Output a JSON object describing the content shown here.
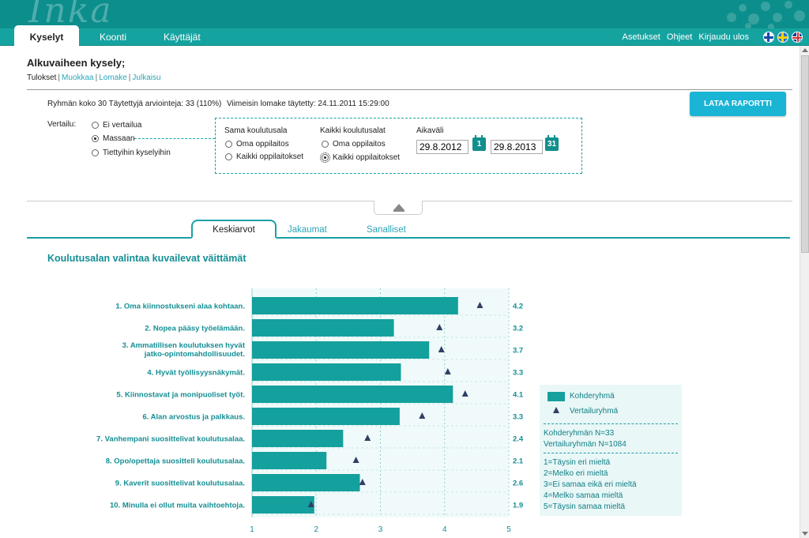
{
  "app": {
    "logo": "Inka"
  },
  "nav": {
    "tabs": [
      "Kyselyt",
      "Koonti",
      "Käyttäjät"
    ],
    "links": [
      "Asetukset",
      "Ohjeet",
      "Kirjaudu ulos"
    ]
  },
  "page": {
    "title": "Alkuvaiheen kysely;",
    "crumb_current": "Tulokset",
    "crumb_links": [
      "Muokkaa",
      "Lomake",
      "Julkaisu"
    ]
  },
  "info": {
    "group": "Ryhmän koko 30 Täytettyjä arviointeja: 33 (110%)",
    "last_filled": "Viimeisin lomake täytetty: 24.11.2011 15:29:00",
    "report_button": "LATAA RAPORTTI"
  },
  "compare": {
    "label": "Vertailu:",
    "options": [
      "Ei vertailua",
      "Massaan",
      "Tiettyihin kyselyihin"
    ],
    "selected": 1,
    "same_field": {
      "heading": "Sama koulutusala",
      "options": [
        "Oma oppilaitos",
        "Kaikki oppilaitokset"
      ]
    },
    "all_fields": {
      "heading": "Kaikki koulutusalat",
      "options": [
        "Oma oppilaitos",
        "Kaikki oppilaitokset"
      ],
      "selected": 1
    },
    "period": {
      "heading": "Aikaväli",
      "start": "29.8.2012",
      "end": "29.8.2013",
      "cal_start": "1",
      "cal_end": "31"
    }
  },
  "subtabs": [
    "Keskiarvot",
    "Jakaumat",
    "Sanalliset"
  ],
  "chart_title": "Koulutusalan valintaa kuvailevat väittämät",
  "colors": {
    "bar": "#14a09d",
    "marker": "#2f3f66",
    "label": "#138f94"
  },
  "chart_data": {
    "type": "bar",
    "orientation": "horizontal",
    "xlim": [
      1,
      5
    ],
    "xticks": [
      1,
      2,
      3,
      4,
      5
    ],
    "categories": [
      [
        "1. Oma kiinnostukseni alaa kohtaan."
      ],
      [
        "2. Nopea pääsy työelämään."
      ],
      [
        "3. Ammatillisen koulutuksen hyvät",
        "jatko-opintomahdollisuudet."
      ],
      [
        "4. Hyvät työllisyysnäkymät."
      ],
      [
        "5. Kiinnostavat ja monipuoliset työt."
      ],
      [
        "6. Alan arvostus ja palkkaus."
      ],
      [
        "7. Vanhempani suosittelivat koulutusalaa."
      ],
      [
        "8. Opo/opettaja suositteli koulutusalaa."
      ],
      [
        "9. Kaverit suosittelivat koulutusalaa."
      ],
      [
        "10. Minulla ei ollut muita vaihtoehtoja."
      ]
    ],
    "series": [
      {
        "name": "Kohderyhmä",
        "values": [
          4.21,
          3.21,
          3.76,
          3.32,
          4.13,
          3.3,
          2.42,
          2.16,
          2.68,
          1.97
        ]
      },
      {
        "name": "Vertailuryhmä",
        "values": [
          4.55,
          3.92,
          3.95,
          4.05,
          4.32,
          3.65,
          2.8,
          2.62,
          2.72,
          1.92
        ]
      }
    ],
    "value_labels": [
      "4.2",
      "3.2",
      "3.7",
      "3.3",
      "4.1",
      "3.3",
      "2.4",
      "2.1",
      "2.6",
      "1.9"
    ]
  },
  "legend": {
    "series": [
      "Kohderyhmä",
      "Vertailuryhmä"
    ],
    "n_lines": [
      "Kohderyhmän N=33",
      "Vertailuryhmän N=1084"
    ],
    "scale": [
      "1=Täysin eri mieltä",
      "2=Melko eri mieltä",
      "3=Ei samaa eikä eri mieltä",
      "4=Melko samaa mieltä",
      "5=Täysin samaa mieltä"
    ]
  }
}
